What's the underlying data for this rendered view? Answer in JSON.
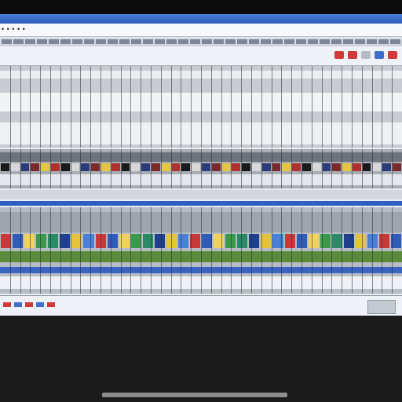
{
  "window": {
    "title": "",
    "address": "· · · · · · · ·",
    "app_label": "• • • • •"
  },
  "toolbar": {
    "menu_count": 36,
    "tools": [
      {
        "name": "red-tool-icon",
        "color": "#d23a3a"
      },
      {
        "name": "red-tool-icon",
        "color": "#d23a3a"
      },
      {
        "name": "grey-tool-icon",
        "color": "#b6bcc6"
      },
      {
        "name": "blue-tool-icon",
        "color": "#3f6fc9"
      },
      {
        "name": "red-tool-icon",
        "color": "#d23a3a"
      }
    ]
  },
  "palette": {
    "accent": "#2d5fc2",
    "cells": [
      "#2e5cb8",
      "#e3c43a",
      "#3b9a4a",
      "#c83a3a",
      "#1f3f8f",
      "#f0d35a",
      "#4a7fd8",
      "#2b8a66"
    ]
  },
  "status": {
    "chips": [
      "#d23a3a",
      "#3f6fc9",
      "#d23a3a",
      "#3f6fc9",
      "#d23a3a"
    ]
  }
}
